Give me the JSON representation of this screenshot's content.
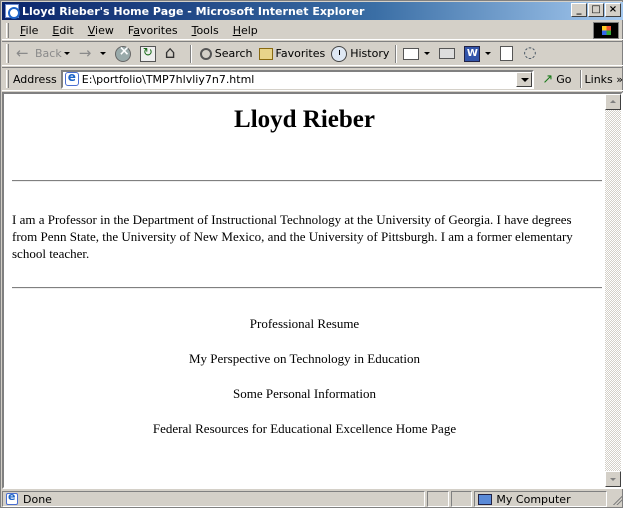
{
  "window": {
    "title": "Lloyd Rieber's Home Page - Microsoft Internet Explorer",
    "controls": {
      "minimize": "_",
      "maximize": "□",
      "close": "×"
    }
  },
  "menu": {
    "items": [
      {
        "label": "File",
        "accel": "F"
      },
      {
        "label": "Edit",
        "accel": "E"
      },
      {
        "label": "View",
        "accel": "V"
      },
      {
        "label": "Favorites",
        "accel": "a"
      },
      {
        "label": "Tools",
        "accel": "T"
      },
      {
        "label": "Help",
        "accel": "H"
      }
    ]
  },
  "toolbar": {
    "back_label": "Back",
    "search_label": "Search",
    "favorites_label": "Favorites",
    "history_label": "History"
  },
  "address": {
    "label": "Address",
    "value": "E:\\portfolio\\TMP7hlvliy7n7.html",
    "go_label": "Go",
    "links_label": "Links »"
  },
  "page": {
    "title": "Lloyd Rieber",
    "bio": "I am a Professor in the Department of Instructional Technology at the University of Georgia. I have degrees from Penn State, the University of New Mexico, and the University of Pittsburgh. I am a former elementary school teacher.",
    "links": [
      "Professional Resume",
      "My Perspective on Technology in Education",
      "Some Personal Information",
      "Federal Resources for Educational Excellence Home Page"
    ]
  },
  "status": {
    "text": "Done",
    "zone": "My Computer"
  },
  "colors": {
    "titlebar_start": "#0a246a",
    "titlebar_end": "#a6caf0",
    "chrome": "#d4d0c8",
    "page_background": "#ffffff"
  }
}
